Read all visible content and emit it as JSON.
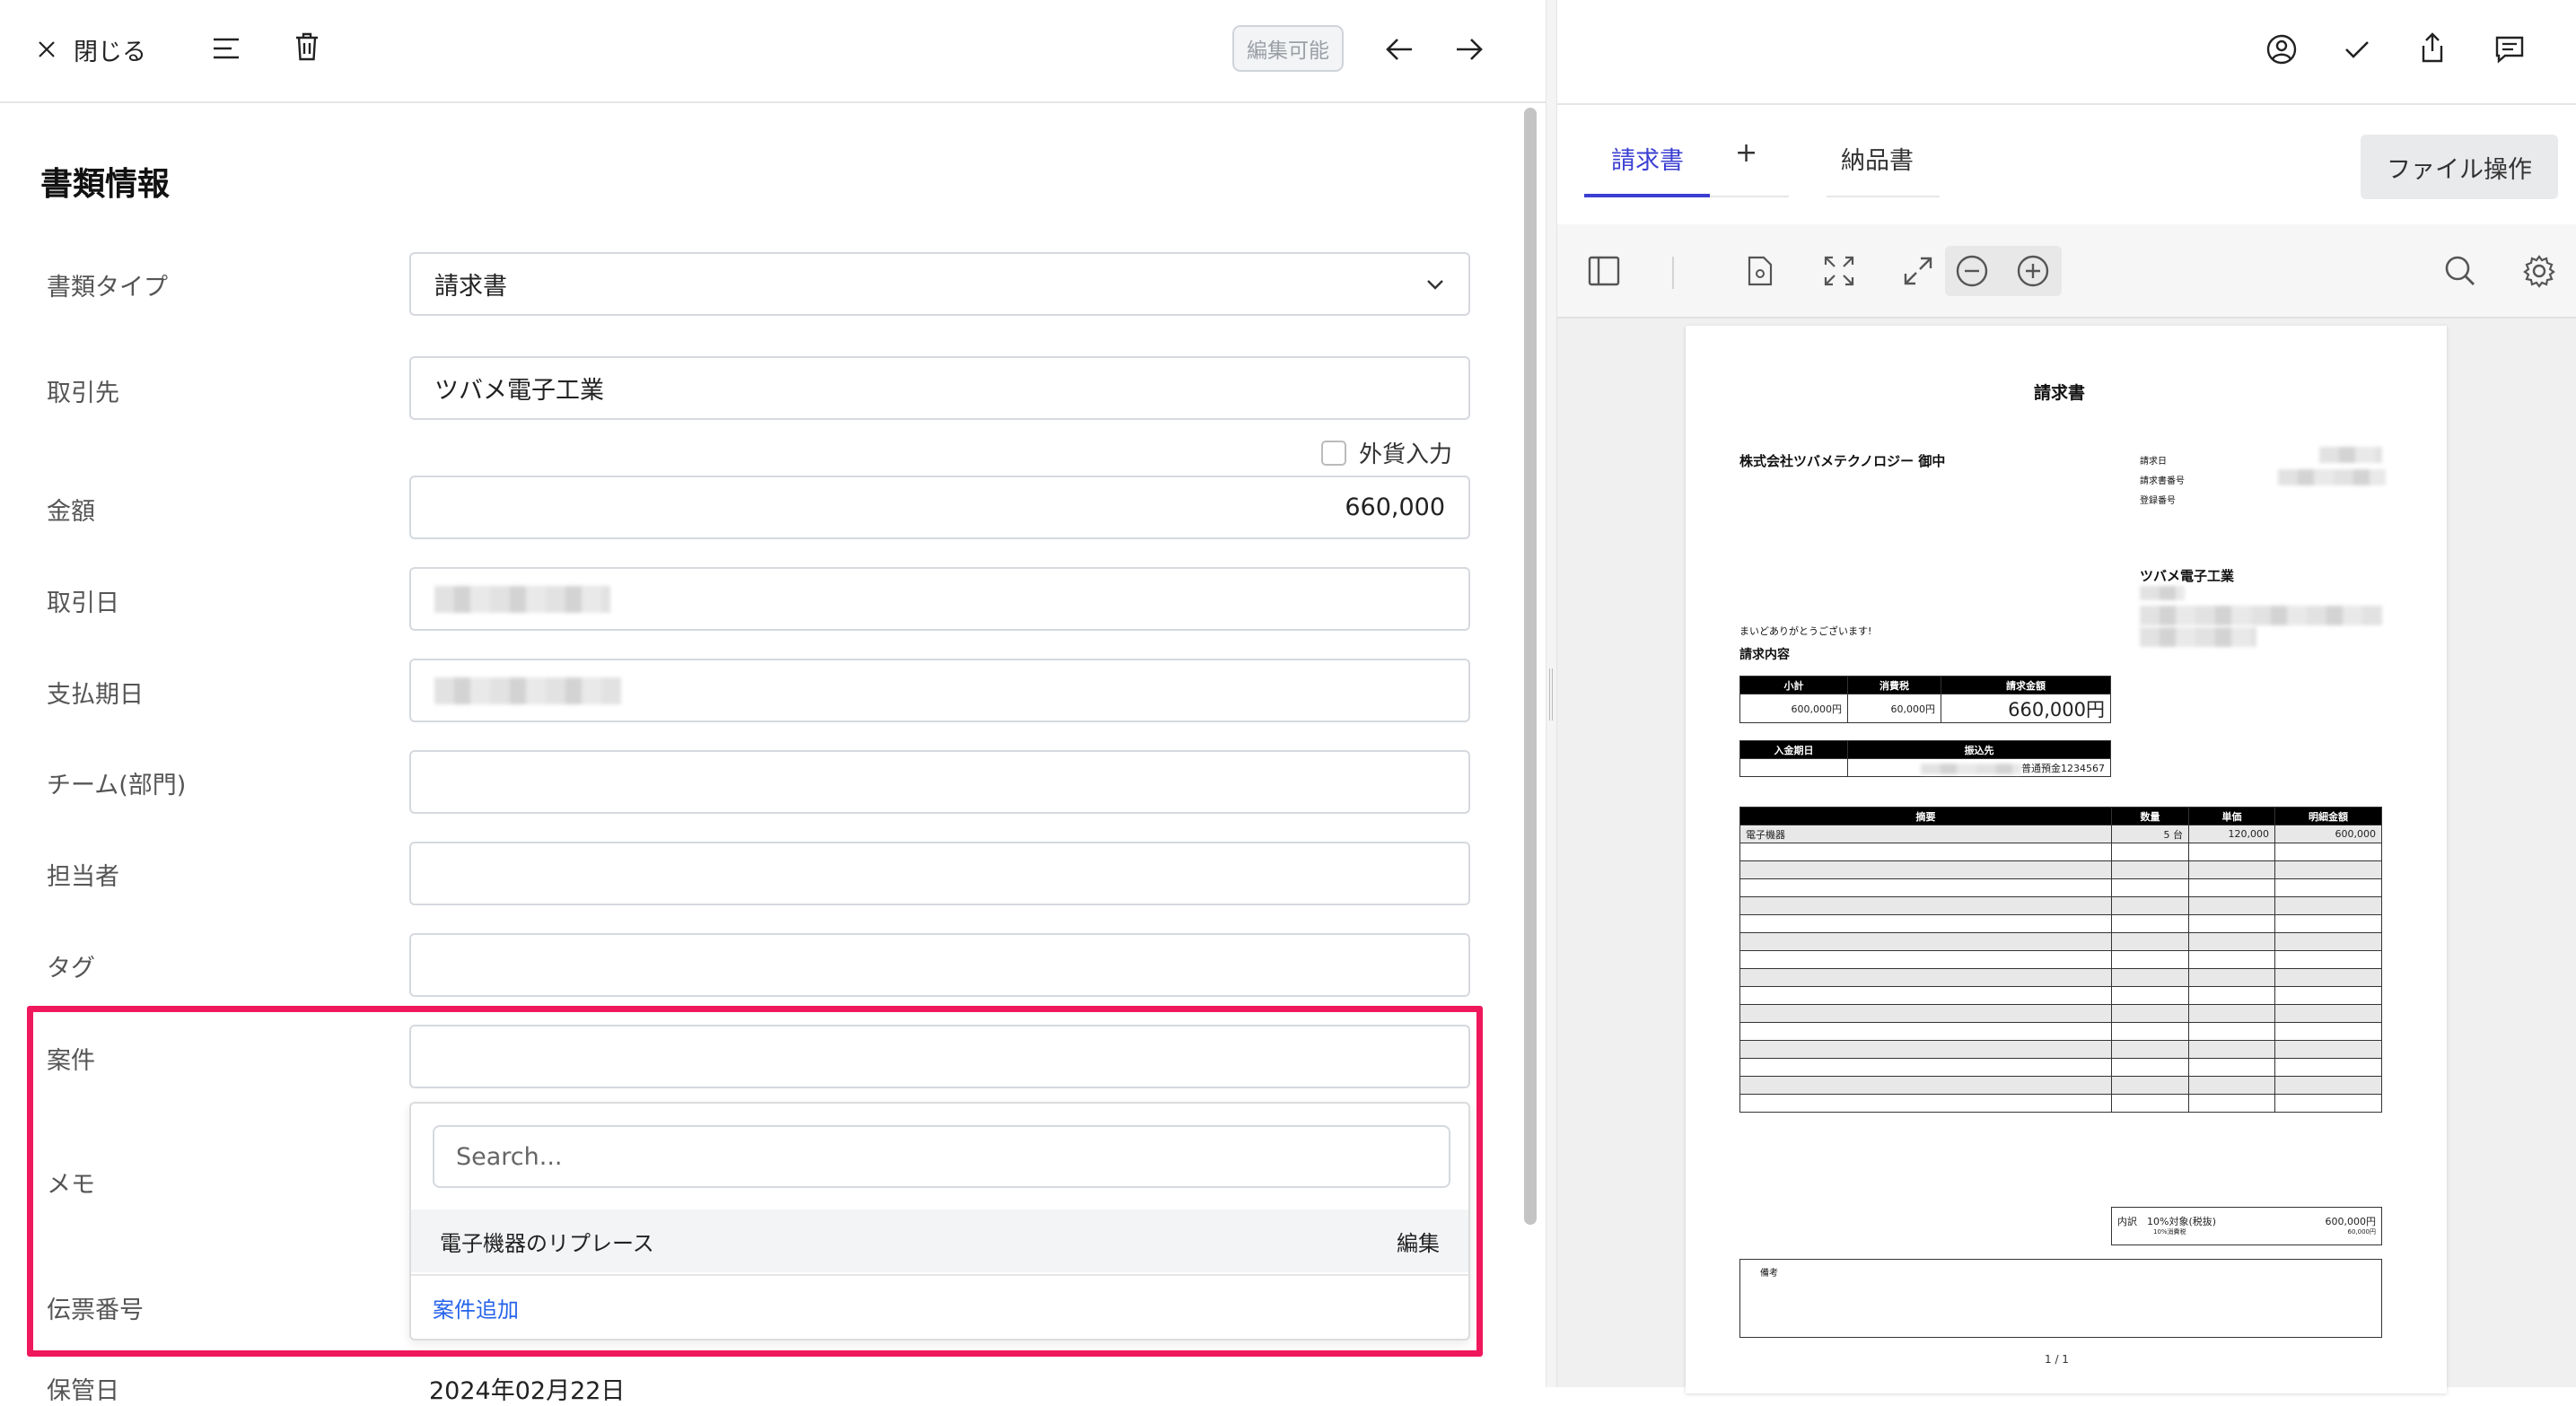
{
  "toolbar": {
    "close_label": "閉じる",
    "edit_badge": "編集可能"
  },
  "form": {
    "section_title": "書類情報",
    "doc_type": {
      "label": "書類タイプ",
      "value": "請求書"
    },
    "partner": {
      "label": "取引先",
      "value": "ツバメ電子工業"
    },
    "foreign_currency": {
      "label": "外貨入力",
      "checked": false
    },
    "amount": {
      "label": "金額",
      "value": "660,000"
    },
    "transaction_date": {
      "label": "取引日",
      "value": ""
    },
    "due_date": {
      "label": "支払期日",
      "value": ""
    },
    "team": {
      "label": "チーム(部門)",
      "value": ""
    },
    "assignee": {
      "label": "担当者",
      "value": ""
    },
    "tags": {
      "label": "タグ",
      "value": ""
    },
    "project": {
      "label": "案件",
      "value": ""
    },
    "memo": {
      "label": "メモ"
    },
    "voucher": {
      "label": "伝票番号"
    },
    "storage_date": {
      "label": "保管日",
      "value": "2024年02月22日"
    }
  },
  "dropdown": {
    "search_placeholder": "Search...",
    "items": [
      {
        "label": "電子機器のリプレース",
        "action": "編集"
      }
    ],
    "add_label": "案件追加"
  },
  "viewer": {
    "tabs": [
      "請求書",
      "納品書"
    ],
    "active_tab": "請求書",
    "add_tab": "+",
    "file_ops_label": "ファイル操作",
    "page_indicator": "1 / 1"
  },
  "invoice": {
    "title": "請求書",
    "recipient": "株式会社ツバメテクノロジー 御中",
    "meta_labels": [
      "請求日",
      "請求書番号",
      "登録番号"
    ],
    "issuer": "ツバメ電子工業",
    "greeting": "まいどありがとうございます!",
    "content_heading": "請求内容",
    "summary_headers": [
      "小計",
      "消費税",
      "請求金額"
    ],
    "summary_values": [
      "600,000円",
      "60,000円",
      "660,000円"
    ],
    "payment_headers": [
      "入金期日",
      "振込先"
    ],
    "payment_account": "普通預金1234567",
    "items_headers": [
      "摘要",
      "数量",
      "単価",
      "明細金額"
    ],
    "items": [
      {
        "desc": "電子機器",
        "qty": "5 台",
        "price": "120,000",
        "amount": "600,000"
      }
    ],
    "breakdown_label": "内訳",
    "breakdown_item": "10%対象(税抜)",
    "breakdown_amount": "600,000円",
    "breakdown_tax_label": "10%消費税",
    "breakdown_tax": "60,000円",
    "remarks_label": "備考"
  },
  "colors": {
    "accent": "#3b3fd1",
    "highlight": "#f0185c",
    "link": "#2563eb"
  }
}
